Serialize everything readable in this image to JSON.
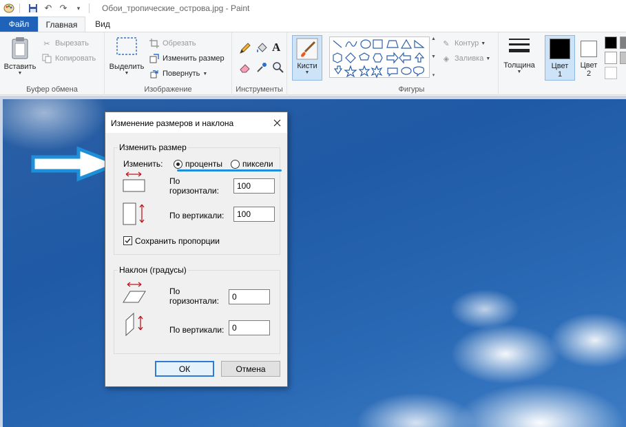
{
  "titlebar": {
    "title": "Обои_тропические_острова.jpg - Paint"
  },
  "tabs": [
    {
      "label": "Файл"
    },
    {
      "label": "Главная"
    },
    {
      "label": "Вид"
    }
  ],
  "ribbon": {
    "clipboard": {
      "paste_label": "Вставить",
      "cut_label": "Вырезать",
      "copy_label": "Копировать",
      "group_label": "Буфер обмена"
    },
    "image": {
      "select_label": "Выделить",
      "crop_label": "Обрезать",
      "resize_label": "Изменить размер",
      "rotate_label": "Повернуть",
      "group_label": "Изображение"
    },
    "tools": {
      "group_label": "Инструменты",
      "text_tool_glyph": "A"
    },
    "brushes": {
      "label": "Кисти"
    },
    "shapes": {
      "outline_label": "Контур",
      "fill_label": "Заливка",
      "group_label": "Фигуры"
    },
    "size": {
      "label": "Толщина"
    },
    "colors": {
      "color1_label_line1": "Цвет",
      "color1_label_line2": "1",
      "color2_label_line1": "Цвет",
      "color2_label_line2": "2",
      "color1_value": "#000000",
      "color2_value": "#ffffff"
    }
  },
  "dialog": {
    "title": "Изменение размеров и наклона",
    "resize": {
      "legend": "Изменить размер",
      "by_label": "Изменить:",
      "percent_label": "проценты",
      "pixels_label": "пиксели",
      "selected": "percent",
      "horizontal_label_line1": "По",
      "horizontal_label_line2": "горизонтали:",
      "horizontal_value": "100",
      "vertical_label": "По вертикали:",
      "vertical_value": "100",
      "keep_ratio_label": "Сохранить пропорции",
      "keep_ratio_checked": true
    },
    "skew": {
      "legend": "Наклон (градусы)",
      "horizontal_label_line1": "По",
      "horizontal_label_line2": "горизонтали:",
      "horizontal_value": "0",
      "vertical_label": "По вертикали:",
      "vertical_value": "0"
    },
    "ok_label": "ОК",
    "cancel_label": "Отмена"
  },
  "annotation": {
    "arrow_color": "#1e8fd8",
    "underline_color": "#1e8fd8"
  }
}
